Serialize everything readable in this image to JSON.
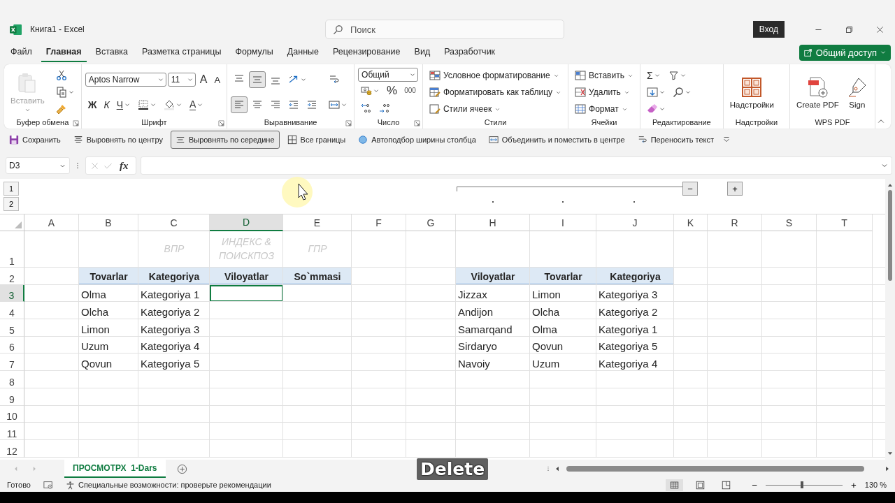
{
  "window": {
    "title": "Книга1  -  Excel",
    "search_placeholder": "Поиск",
    "sign_in": "Вход"
  },
  "menu_tabs": [
    {
      "label": "Файл",
      "selected": false
    },
    {
      "label": "Главная",
      "selected": true
    },
    {
      "label": "Вставка",
      "selected": false
    },
    {
      "label": "Разметка страницы",
      "selected": false
    },
    {
      "label": "Формулы",
      "selected": false
    },
    {
      "label": "Данные",
      "selected": false
    },
    {
      "label": "Рецензирование",
      "selected": false
    },
    {
      "label": "Вид",
      "selected": false
    },
    {
      "label": "Разработчик",
      "selected": false
    }
  ],
  "share_button": "Общий доступ",
  "ribbon": [
    {
      "label": "Буфер обмена",
      "launcher": true,
      "columns": [
        [
          [
            {
              "kind": "big",
              "label": "Вставить",
              "disabled": true
            }
          ]
        ],
        [
          [
            {
              "kind": "tool"
            }
          ],
          [
            {
              "kind": "tool-menu"
            }
          ],
          [
            {
              "kind": "tool"
            }
          ]
        ]
      ]
    },
    {
      "label": "Шрифт",
      "launcher": true,
      "columns": [
        [
          [
            {
              "kind": "font-select",
              "value": "Aptos Narrow"
            },
            {
              "kind": "size-select",
              "value": "11"
            },
            {
              "kind": "grow",
              "label": "A"
            },
            {
              "kind": "shrink",
              "label": "A"
            }
          ],
          [
            {
              "kind": "bold",
              "label": "Ж"
            },
            {
              "kind": "italic",
              "label": "К"
            },
            {
              "kind": "underline",
              "label": "Ч"
            },
            {
              "kind": "tool-menu"
            },
            {
              "kind": "tool-menu"
            },
            {
              "kind": "font-color",
              "label": "A"
            }
          ]
        ]
      ]
    },
    {
      "label": "Выравнивание",
      "launcher": true,
      "columns": [
        [
          [
            {
              "kind": "tool",
              "selected": false
            },
            {
              "kind": "tool",
              "selected": true
            },
            {
              "kind": "tool",
              "selected": false
            },
            {
              "kind": "tool-menu",
              "selected": false
            }
          ],
          [
            {
              "kind": "tool",
              "selected": true
            },
            {
              "kind": "tool",
              "selected": false
            },
            {
              "kind": "tool",
              "selected": false
            },
            {
              "kind": "tool",
              "selected": false
            },
            {
              "kind": "tool",
              "selected": false
            }
          ]
        ],
        [
          [
            {
              "kind": "tool",
              "selected": false
            }
          ],
          [
            {
              "kind": "tool-menu",
              "selected": false
            }
          ]
        ]
      ]
    },
    {
      "label": "Число",
      "launcher": true,
      "columns": [
        [
          [
            {
              "kind": "format-select",
              "value": "Общий"
            }
          ],
          [
            {
              "kind": "tool-menu"
            },
            {
              "kind": "percent",
              "label": "%"
            },
            {
              "kind": "thousands",
              "label": "000"
            }
          ],
          [
            {
              "kind": "tool"
            },
            {
              "kind": "tool"
            }
          ]
        ]
      ]
    },
    {
      "label": "Стили",
      "launcher": false,
      "columns": [
        [
          [
            {
              "kind": "labeled-menu",
              "label": "Условное форматирование"
            }
          ],
          [
            {
              "kind": "labeled-menu",
              "label": "Форматировать как таблицу"
            }
          ],
          [
            {
              "kind": "labeled-menu",
              "label": "Стили ячеек"
            }
          ]
        ]
      ]
    },
    {
      "label": "Ячейки",
      "launcher": false,
      "columns": [
        [
          [
            {
              "kind": "labeled-menu",
              "label": "Вставить"
            }
          ],
          [
            {
              "kind": "labeled-menu",
              "label": "Удалить"
            }
          ],
          [
            {
              "kind": "labeled-menu",
              "label": "Формат"
            }
          ]
        ]
      ]
    },
    {
      "label": "Редактирование",
      "launcher": false,
      "columns": [
        [
          [
            {
              "kind": "sum",
              "label": "Σ"
            },
            {
              "kind": "tool-menu"
            }
          ],
          [
            {
              "kind": "tool-menu"
            },
            {
              "kind": "tool-menu"
            }
          ],
          [
            {
              "kind": "tool-menu"
            }
          ]
        ]
      ]
    },
    {
      "label": "Надстройки",
      "launcher": false,
      "columns": [
        [
          [
            {
              "kind": "big",
              "label": "Надстройки",
              "disabled": false
            }
          ]
        ]
      ]
    },
    {
      "label": "WPS PDF",
      "launcher": false,
      "columns": [
        [
          [
            {
              "kind": "big",
              "label": "Create PDF",
              "disabled": false
            },
            {
              "kind": "big",
              "label": "Sign",
              "disabled": false
            }
          ]
        ]
      ]
    }
  ],
  "quick_toolbar": [
    {
      "label": "Сохранить",
      "selected": false
    },
    {
      "label": "Выровнять по центру",
      "selected": false
    },
    {
      "label": "Выровнять по середине",
      "selected": true
    },
    {
      "label": "Все границы",
      "selected": false
    },
    {
      "label": "Автоподбор ширины столбца",
      "selected": false
    },
    {
      "label": "Объединить и поместить в центре",
      "selected": false
    },
    {
      "label": "Переносить текст",
      "selected": false
    }
  ],
  "formula_bar": {
    "name_box": "D3",
    "function_label": "fx"
  },
  "outline": {
    "levels": [
      "1",
      "2"
    ],
    "collapse": "−",
    "expand": "+"
  },
  "columns": [
    {
      "label": "A",
      "selected": false
    },
    {
      "label": "B",
      "selected": false
    },
    {
      "label": "C",
      "selected": false
    },
    {
      "label": "D",
      "selected": true
    },
    {
      "label": "E",
      "selected": false
    },
    {
      "label": "F",
      "selected": false
    },
    {
      "label": "G",
      "selected": false
    },
    {
      "label": "H",
      "selected": false
    },
    {
      "label": "I",
      "selected": false
    },
    {
      "label": "J",
      "selected": false
    },
    {
      "label": "K",
      "selected": false
    },
    {
      "label": "R",
      "selected": false
    },
    {
      "label": "S",
      "selected": false
    },
    {
      "label": "T",
      "selected": false
    }
  ],
  "rows": [
    {
      "label": "1",
      "selected": false
    },
    {
      "label": "2",
      "selected": false
    },
    {
      "label": "3",
      "selected": true
    },
    {
      "label": "4",
      "selected": false
    },
    {
      "label": "5",
      "selected": false
    },
    {
      "label": "6",
      "selected": false
    },
    {
      "label": "7",
      "selected": false
    },
    {
      "label": "8",
      "selected": false
    },
    {
      "label": "9",
      "selected": false
    },
    {
      "label": "10",
      "selected": false
    },
    {
      "label": "11",
      "selected": false
    },
    {
      "label": "12",
      "selected": false
    }
  ],
  "hints": [
    "ВПР",
    "ИНДЕКС & ПОИСКПОЗ",
    "ГПР"
  ],
  "tables": [
    {
      "headers": [
        "Tovarlar",
        "Kategoriya",
        "Viloyatlar",
        "So`mmasi"
      ],
      "rows": [
        [
          "Olma",
          "Kategoriya 1"
        ],
        [
          "Olcha",
          "Kategoriya 2"
        ],
        [
          "Limon",
          "Kategoriya 3"
        ],
        [
          "Uzum",
          "Kategoriya 4"
        ],
        [
          "Qovun",
          "Kategoriya 5"
        ]
      ]
    },
    {
      "headers": [
        "Viloyatlar",
        "Tovarlar",
        "Kategoriya"
      ],
      "rows": [
        [
          "Jizzax",
          "Limon",
          "Kategoriya 3"
        ],
        [
          "Andijon",
          "Olcha",
          "Kategoriya 2"
        ],
        [
          "Samarqand",
          "Olma",
          "Kategoriya 1"
        ],
        [
          "Sirdaryo",
          "Qovun",
          "Kategoriya 5"
        ],
        [
          "Navoiy",
          "Uzum",
          "Kategoriya 4"
        ]
      ]
    }
  ],
  "sheet_tabs": [
    {
      "label": "ПРОСМОТРХ  1-Dars",
      "selected": true
    }
  ],
  "key_overlay": "Delete",
  "status_bar": {
    "ready": "Готово",
    "accessibility": "Специальные возможности: проверьте рекомендации",
    "views": [
      {
        "kind": "normal",
        "selected": true
      },
      {
        "kind": "page-layout",
        "selected": false
      },
      {
        "kind": "page-break",
        "selected": false
      }
    ],
    "zoom": {
      "zoom_out": "−",
      "level": 0.47,
      "zoom_in": "+",
      "reading": "130 %"
    }
  }
}
